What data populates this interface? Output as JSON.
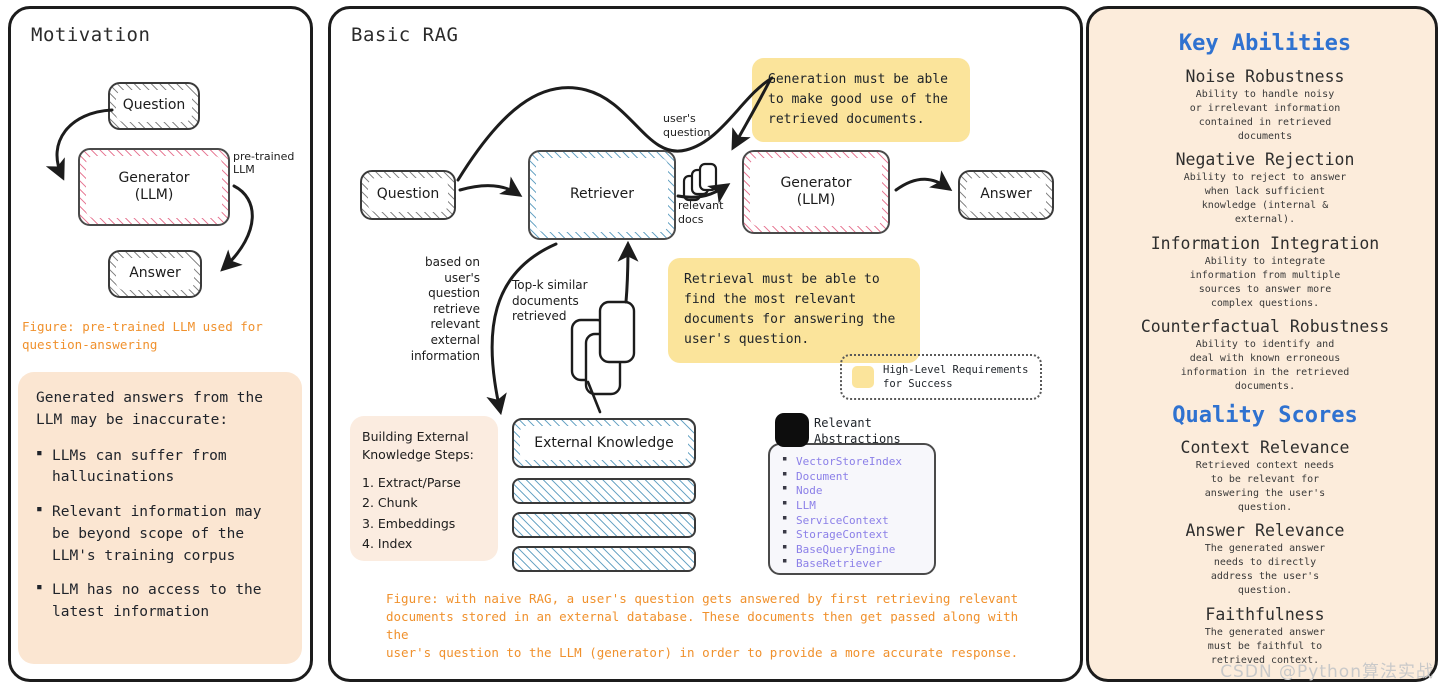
{
  "panels": {
    "motivation": {
      "title": "Motivation",
      "nodes": {
        "question": "Question",
        "generator": "Generator\n(LLM)",
        "answer": "Answer"
      },
      "edge_label": "pre-trained\nLLM",
      "caption": "Figure: pre-trained LLM used for\nquestion-answering",
      "card": {
        "lead": "Generated answers from the\nLLM may be inaccurate:",
        "bullets": [
          "LLMs can suffer from hallucinations",
          "Relevant information may be beyond scope of the LLM's training corpus",
          "LLM has no access to the latest information"
        ]
      }
    },
    "basic_rag": {
      "title": "Basic RAG",
      "nodes": {
        "question": "Question",
        "retriever": "Retriever",
        "generator": "Generator\n(LLM)",
        "answer": "Answer"
      },
      "edge_labels": {
        "users_question": "user's\nquestion",
        "relevant_docs": "relevant\ndocs",
        "based_on": "based on\nuser's\nquestion\nretrieve\nrelevant\nexternal\ninformation",
        "topk": "Top-k similar\ndocuments\nretrieved"
      },
      "callouts": {
        "generation": "Generation must be able\nto make good use of the\nretrieved documents.",
        "retrieval": "Retrieval must be able to\nfind the most relevant\ndocuments for answering the\nuser's question."
      },
      "legend": {
        "text": "High-Level Requirements\nfor Success",
        "swatch_color": "#fbe49b"
      },
      "steps_card": {
        "header": "Building External\nKnowledge Steps:",
        "steps": [
          "1. Extract/Parse",
          "2. Chunk",
          "3. Embeddings",
          "4. Index"
        ]
      },
      "external_knowledge": {
        "label": "External Knowledge",
        "slab_count": 3
      },
      "abstractions": {
        "title": "Relevant\nAbstractions",
        "items": [
          "VectorStoreIndex",
          "Document",
          "Node",
          "LLM",
          "ServiceContext",
          "StorageContext",
          "BaseQueryEngine",
          "BaseRetriever"
        ],
        "text_color": "#8b7fe8"
      },
      "caption": "Figure: with naive RAG, a user's question gets answered by first retrieving relevant\ndocuments stored in an external database. These documents then get passed along with the\nuser's question to the LLM (generator) in order to provide a more accurate response."
    },
    "key_abilities": {
      "heading_1": "Key Abilities",
      "heading_2": "Quality Scores",
      "heading_color": "#2f72d0",
      "abilities": [
        {
          "name": "Noise Robustness",
          "desc": "Ability to handle noisy\nor irrelevant information\ncontained in retrieved\ndocuments"
        },
        {
          "name": "Negative Rejection",
          "desc": "Ability to reject to answer\nwhen lack sufficient\nknowledge (internal &\nexternal)."
        },
        {
          "name": "Information Integration",
          "desc": "Ability to integrate\ninformation from multiple\nsources to answer more\ncomplex questions."
        },
        {
          "name": "Counterfactual Robustness",
          "desc": "Ability to identify and\ndeal with known erroneous\ninformation in the retrieved\ndocuments."
        }
      ],
      "scores": [
        {
          "name": "Context Relevance",
          "desc": "Retrieved context needs\nto be relevant for\nanswering the user's\nquestion."
        },
        {
          "name": "Answer Relevance",
          "desc": "The generated answer\nneeds to directly\naddress the user's\nquestion."
        },
        {
          "name": "Faithfulness",
          "desc": "The generated answer\nmust be faithful to\nretrieved context."
        }
      ]
    }
  },
  "watermark": "CSDN @Python算法实战",
  "colors": {
    "accent_orange": "#f0912d",
    "callout_yellow": "#fbe49b",
    "panel_beige": "#fcecdb",
    "card_beige": "#fbe6d2",
    "heading_blue": "#2f72d0",
    "abstraction_purple": "#8b7fe8",
    "hatch_pink": "#e8809a",
    "hatch_blue": "#6fa8c7"
  }
}
